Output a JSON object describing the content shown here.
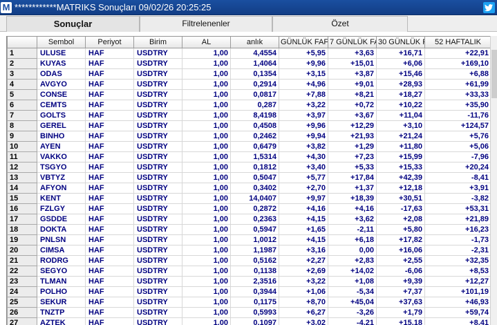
{
  "window": {
    "logo": "M",
    "title": "************MATRIKS Sonuçları 09/02/26 20:25:25",
    "twitter_icon": "twitter-icon"
  },
  "tabs": [
    {
      "label": "Sonuçlar",
      "active": true
    },
    {
      "label": "Filtrelenenler",
      "active": false
    },
    {
      "label": "Özet",
      "active": false
    }
  ],
  "table": {
    "columns": [
      "",
      "Sembol",
      "Periyot",
      "Birim",
      "AL",
      "anlık",
      "GÜNLÜK FAF",
      "7 GÜNLÜK FA",
      "30 GÜNLÜK F",
      "52 HAFTALIK"
    ],
    "rows": [
      [
        "1",
        "ULUSE",
        "HAF",
        "USDTRY",
        "1,00",
        "4,4554",
        "+5,95",
        "+3,63",
        "+16,71",
        "+22,91"
      ],
      [
        "2",
        "KUYAS",
        "HAF",
        "USDTRY",
        "1,00",
        "1,4064",
        "+9,96",
        "+15,01",
        "+6,06",
        "+169,10"
      ],
      [
        "3",
        "ODAS",
        "HAF",
        "USDTRY",
        "1,00",
        "0,1354",
        "+3,15",
        "+3,87",
        "+15,46",
        "+6,88"
      ],
      [
        "4",
        "AVGYO",
        "HAF",
        "USDTRY",
        "1,00",
        "0,2914",
        "+4,96",
        "+9,01",
        "+28,93",
        "+61,99"
      ],
      [
        "5",
        "CONSE",
        "HAF",
        "USDTRY",
        "1,00",
        "0,0817",
        "+7,88",
        "+8,21",
        "+18,27",
        "+33,33"
      ],
      [
        "6",
        "CEMTS",
        "HAF",
        "USDTRY",
        "1,00",
        "0,287",
        "+3,22",
        "+0,72",
        "+10,22",
        "+35,90"
      ],
      [
        "7",
        "GOLTS",
        "HAF",
        "USDTRY",
        "1,00",
        "8,4198",
        "+3,97",
        "+3,67",
        "+11,04",
        "-11,76"
      ],
      [
        "8",
        "GEREL",
        "HAF",
        "USDTRY",
        "1,00",
        "0,4508",
        "+9,96",
        "+12,29",
        "+3,10",
        "+124,57"
      ],
      [
        "9",
        "BINHO",
        "HAF",
        "USDTRY",
        "1,00",
        "0,2462",
        "+9,94",
        "+21,93",
        "+21,24",
        "+5,76"
      ],
      [
        "10",
        "AYEN",
        "HAF",
        "USDTRY",
        "1,00",
        "0,6479",
        "+3,82",
        "+1,29",
        "+11,80",
        "+5,06"
      ],
      [
        "11",
        "VAKKO",
        "HAF",
        "USDTRY",
        "1,00",
        "1,5314",
        "+4,30",
        "+7,23",
        "+15,99",
        "-7,96"
      ],
      [
        "12",
        "TSGYO",
        "HAF",
        "USDTRY",
        "1,00",
        "0,1812",
        "+3,40",
        "+5,33",
        "+15,33",
        "+20,24"
      ],
      [
        "13",
        "VBTYZ",
        "HAF",
        "USDTRY",
        "1,00",
        "0,5047",
        "+5,77",
        "+17,84",
        "+42,39",
        "-8,41"
      ],
      [
        "14",
        "AFYON",
        "HAF",
        "USDTRY",
        "1,00",
        "0,3402",
        "+2,70",
        "+1,37",
        "+12,18",
        "+3,91"
      ],
      [
        "15",
        "KENT",
        "HAF",
        "USDTRY",
        "1,00",
        "14,0407",
        "+9,97",
        "+18,39",
        "+30,51",
        "-3,82"
      ],
      [
        "16",
        "FZLGY",
        "HAF",
        "USDTRY",
        "1,00",
        "0,2872",
        "+4,16",
        "+4,16",
        "-17,63",
        "+53,31"
      ],
      [
        "17",
        "GSDDE",
        "HAF",
        "USDTRY",
        "1,00",
        "0,2363",
        "+4,15",
        "+3,62",
        "+2,08",
        "+21,89"
      ],
      [
        "18",
        "DOKTA",
        "HAF",
        "USDTRY",
        "1,00",
        "0,5947",
        "+1,65",
        "-2,11",
        "+5,80",
        "+16,23"
      ],
      [
        "19",
        "PNLSN",
        "HAF",
        "USDTRY",
        "1,00",
        "1,0012",
        "+4,15",
        "+6,18",
        "+17,82",
        "-1,73"
      ],
      [
        "20",
        "CIMSA",
        "HAF",
        "USDTRY",
        "1,00",
        "1,1987",
        "+3,16",
        "0,00",
        "+16,06",
        "-2,31"
      ],
      [
        "21",
        "RODRG",
        "HAF",
        "USDTRY",
        "1,00",
        "0,5162",
        "+2,27",
        "+2,83",
        "+2,55",
        "+32,35"
      ],
      [
        "22",
        "SEGYO",
        "HAF",
        "USDTRY",
        "1,00",
        "0,1138",
        "+2,69",
        "+14,02",
        "-6,06",
        "+8,53"
      ],
      [
        "23",
        "TLMAN",
        "HAF",
        "USDTRY",
        "1,00",
        "2,3516",
        "+3,22",
        "+1,08",
        "+9,39",
        "+12,27"
      ],
      [
        "24",
        "POLHO",
        "HAF",
        "USDTRY",
        "1,00",
        "0,3944",
        "+1,06",
        "-5,34",
        "+7,37",
        "+101,19"
      ],
      [
        "25",
        "SEKUR",
        "HAF",
        "USDTRY",
        "1,00",
        "0,1175",
        "+8,70",
        "+45,04",
        "+37,63",
        "+46,93"
      ],
      [
        "26",
        "TNZTP",
        "HAF",
        "USDTRY",
        "1,00",
        "0,5993",
        "+6,27",
        "-3,26",
        "+1,79",
        "+59,74"
      ],
      [
        "27",
        "AZTEK",
        "HAF",
        "USDTRY",
        "1,00",
        "0,1097",
        "+3,02",
        "-4,21",
        "+15,18",
        "+8,41"
      ]
    ]
  },
  "colors": {
    "text_color": "#000080",
    "title_bg": "#1a4fa0"
  }
}
